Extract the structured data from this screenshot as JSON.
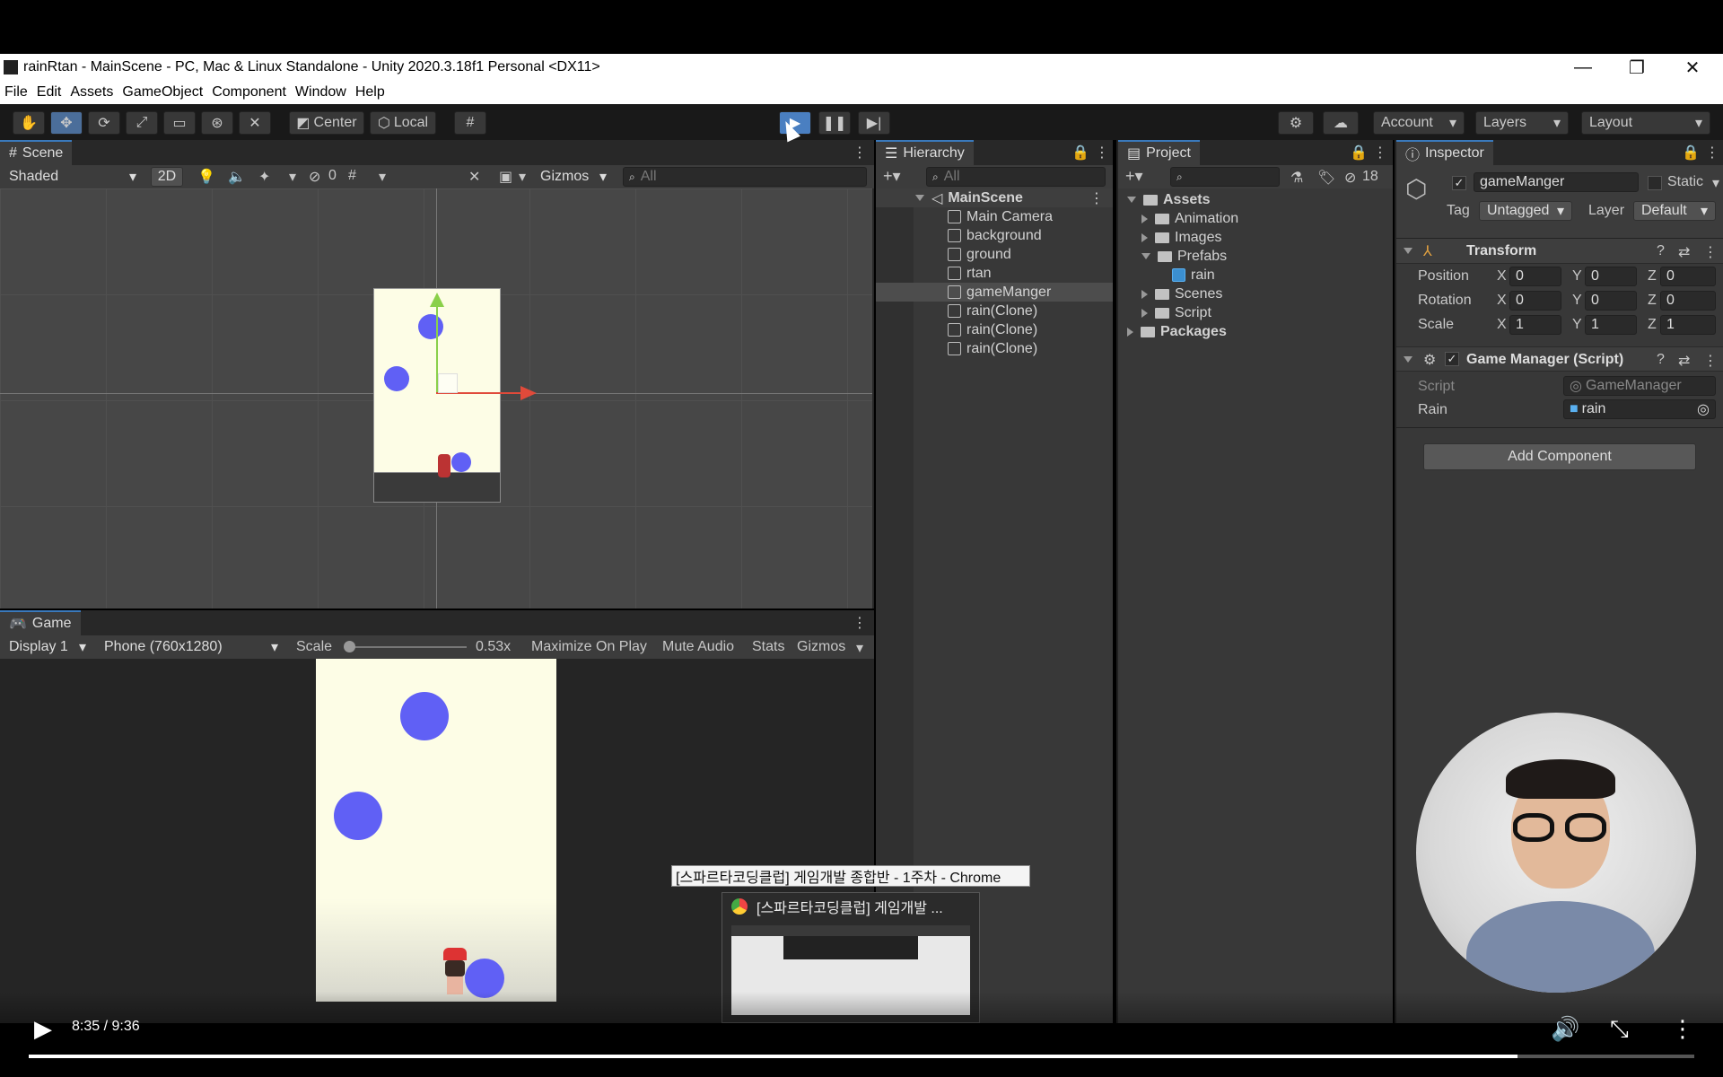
{
  "window": {
    "title": "rainRtan - MainScene - PC, Mac & Linux Standalone - Unity 2020.3.18f1 Personal <DX11>",
    "minimize": "—",
    "restore": "❐",
    "close": "✕"
  },
  "menu": [
    "File",
    "Edit",
    "Assets",
    "GameObject",
    "Component",
    "Window",
    "Help"
  ],
  "toolbar": {
    "pivot_center": "Center",
    "pivot_local": "Local",
    "account": "Account",
    "layers": "Layers",
    "layout": "Layout"
  },
  "scene": {
    "tab": "Scene",
    "shading": "Shaded",
    "mode_2d": "2D",
    "hidden_count": "0",
    "gizmos": "Gizmos",
    "search_placeholder": "All"
  },
  "game": {
    "tab": "Game",
    "display": "Display 1",
    "resolution": "Phone (760x1280)",
    "scale_label": "Scale",
    "scale_value": 0.53,
    "scale_text": "0.53x",
    "maximize": "Maximize On Play",
    "mute": "Mute Audio",
    "stats": "Stats",
    "gizmos": "Gizmos"
  },
  "hierarchy": {
    "tab": "Hierarchy",
    "search_placeholder": "All",
    "scene": "MainScene",
    "items": [
      "Main Camera",
      "background",
      "ground",
      "rtan",
      "gameManger",
      "rain(Clone)",
      "rain(Clone)",
      "rain(Clone)"
    ],
    "selected": "gameManger"
  },
  "project": {
    "tab": "Project",
    "hidden_count": "18",
    "assets": "Assets",
    "folders": [
      "Animation",
      "Images",
      "Prefabs",
      "Scenes",
      "Script"
    ],
    "prefab_item": "rain",
    "packages": "Packages"
  },
  "inspector": {
    "tab": "Inspector",
    "object_name": "gameManger",
    "static": "Static",
    "tag_label": "Tag",
    "tag_value": "Untagged",
    "layer_label": "Layer",
    "layer_value": "Default",
    "transform": {
      "title": "Transform",
      "rows": [
        {
          "label": "Position",
          "x": "0",
          "y": "0",
          "z": "0"
        },
        {
          "label": "Rotation",
          "x": "0",
          "y": "0",
          "z": "0"
        },
        {
          "label": "Scale",
          "x": "1",
          "y": "1",
          "z": "1"
        }
      ]
    },
    "script_component": {
      "title": "Game Manager (Script)",
      "script_label": "Script",
      "script_value": "GameManager",
      "rain_label": "Rain",
      "rain_value": "rain"
    },
    "add_component": "Add Component"
  },
  "taskbar_preview": {
    "tooltip": "[스파르타코딩클럽] 게임개발 종합반 - 1주차 - Chrome",
    "title": "[스파르타코딩클럽] 게임개발 ..."
  },
  "video": {
    "time": "8:35 / 9:36",
    "progress": 0.894
  },
  "colors": {
    "rain": "#6060f5",
    "game_bg": "#fdfde6",
    "accent": "#3a79bb"
  }
}
